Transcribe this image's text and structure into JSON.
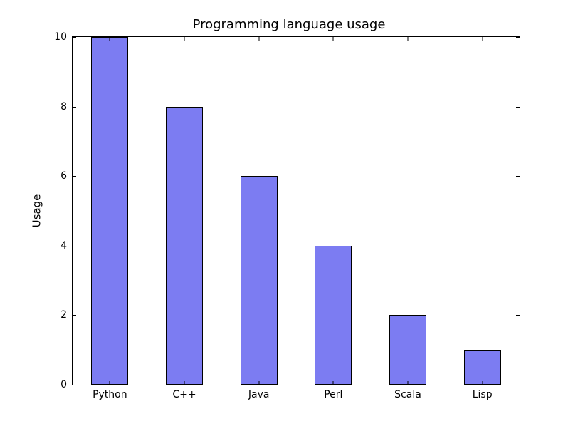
{
  "chart_data": {
    "type": "bar",
    "title": "Programming language usage",
    "categories": [
      "Python",
      "C++",
      "Java",
      "Perl",
      "Scala",
      "Lisp"
    ],
    "values": [
      10,
      8,
      6,
      4,
      2,
      1
    ],
    "ylabel": "Usage",
    "xlabel": "",
    "ylim": [
      0,
      10
    ],
    "yticks": [
      0,
      2,
      4,
      6,
      8,
      10
    ],
    "bar_color": "#7c7cf2"
  }
}
